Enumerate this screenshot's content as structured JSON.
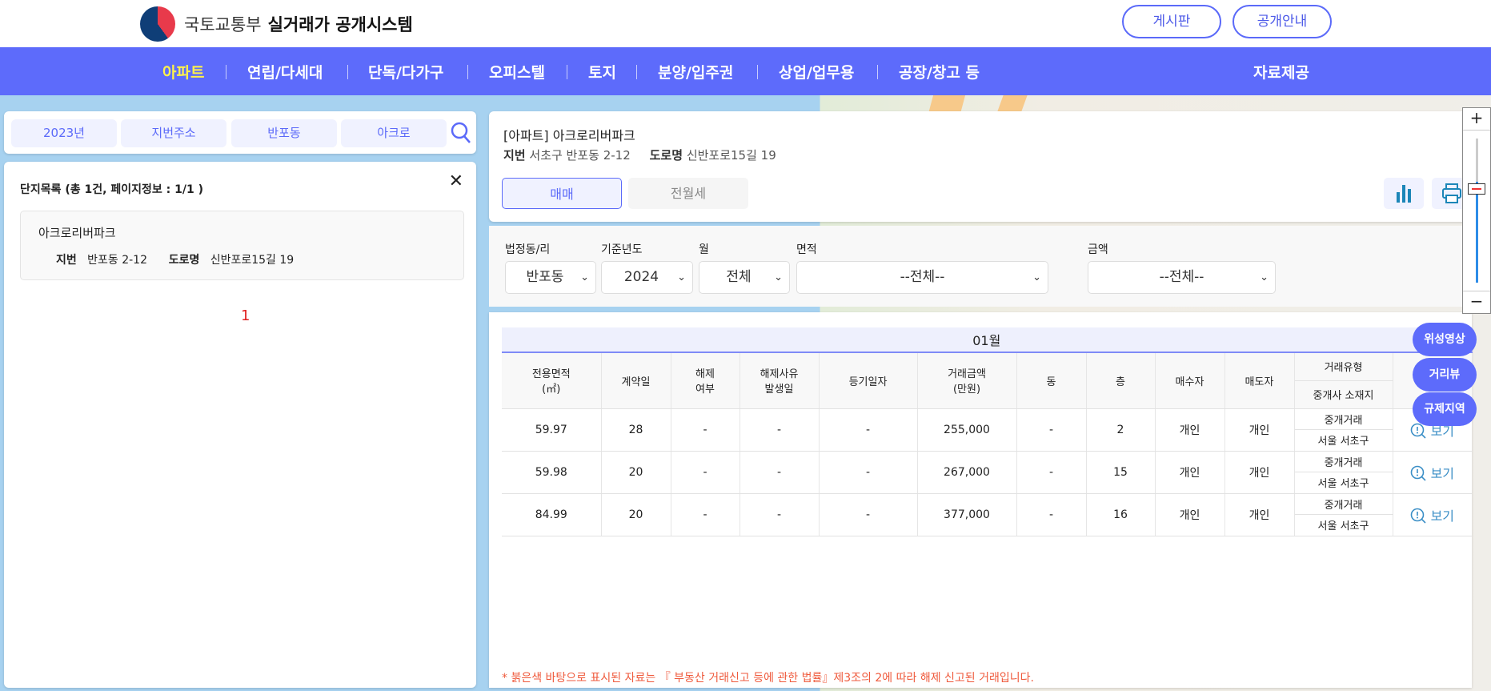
{
  "header": {
    "org": "국토교통부",
    "title": "실거래가 공개시스템",
    "buttons": [
      "게시판",
      "공개안내"
    ]
  },
  "nav": {
    "items": [
      "아파트",
      "연립/다세대",
      "단독/다가구",
      "오피스텔",
      "토지",
      "분양/입주권",
      "상업/업무용",
      "공장/창고 등"
    ],
    "data": "자료제공",
    "active_color": "#fff24a"
  },
  "search": {
    "chips": [
      "2023년",
      "지번주소",
      "반포동",
      "아크로"
    ]
  },
  "list": {
    "title": "단지목록 (총 1건, 페이지정보 : 1/1 )",
    "item": {
      "name": "아크로리버파크",
      "jibun_label": "지번",
      "jibun": "반포동 2-12",
      "road_label": "도로명",
      "road": "신반포로15길 19"
    },
    "page": "1"
  },
  "detail": {
    "title": "[아파트] 아크로리버파크",
    "jibun_label": "지번",
    "jibun": "서초구 반포동 2-12",
    "road_label": "도로명",
    "road": "신반포로15길 19",
    "tabs": [
      "매매",
      "전월세"
    ]
  },
  "filters": {
    "labels": [
      "법정동/리",
      "기준년도",
      "월",
      "면적",
      "금액"
    ],
    "values": [
      "반포동",
      "2024",
      "전체",
      "--전체--",
      "--전체--"
    ]
  },
  "table": {
    "month": "01월",
    "headers": [
      "전용면적\n(㎡)",
      "계약일",
      "해제\n여부",
      "해제사유\n발생일",
      "등기일자",
      "거래금액\n(만원)",
      "동",
      "층",
      "매수자",
      "매도자",
      "거래유형",
      "중개사 소재지"
    ],
    "rows": [
      {
        "area": "59.97",
        "day": "28",
        "cancel": "-",
        "cancel_date": "-",
        "reg": "-",
        "price": "255,000",
        "dong": "-",
        "floor": "2",
        "buyer": "개인",
        "seller": "개인",
        "type": "중개거래",
        "loc": "서울 서초구",
        "view": "보기"
      },
      {
        "area": "59.98",
        "day": "20",
        "cancel": "-",
        "cancel_date": "-",
        "reg": "-",
        "price": "267,000",
        "dong": "-",
        "floor": "15",
        "buyer": "개인",
        "seller": "개인",
        "type": "중개거래",
        "loc": "서울 서초구",
        "view": "보기"
      },
      {
        "area": "84.99",
        "day": "20",
        "cancel": "-",
        "cancel_date": "-",
        "reg": "-",
        "price": "377,000",
        "dong": "-",
        "floor": "16",
        "buyer": "개인",
        "seller": "개인",
        "type": "중개거래",
        "loc": "서울 서초구",
        "view": "보기"
      }
    ]
  },
  "floats": [
    "위성영상",
    "거리뷰",
    "규제지역"
  ],
  "note": "* 붉은색 바탕으로 표시된 자료는 『 부동산 거래신고 등에 관한 법률』제3조의 2에 따라 해제 신고된 거래입니다."
}
